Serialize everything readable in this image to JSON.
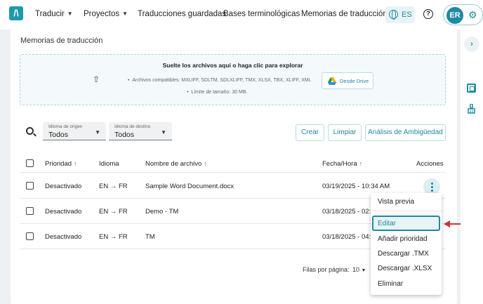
{
  "nav": {
    "logo": "/\\",
    "items": [
      "Traducir",
      "Proyectos",
      "Traducciones guardadas",
      "Bases terminológicas",
      "Memorias de traducción"
    ],
    "language": "ES",
    "help": "?",
    "avatar_initials": "ER"
  },
  "page": {
    "title": "Memorias de traducción"
  },
  "dropzone": {
    "title": "Suelte los archivos aquí o haga clic para explorar",
    "formats": "Archivos compatibles: MXLIFF, SDLTM, SDLXLIFF, TMX, XLSX, TBX, XLIFF, XML",
    "size": "Límite de tamaño: 30 MB.",
    "drive_button": "Desde Drive"
  },
  "filters": {
    "source_label": "Idioma de origen",
    "source_value": "Todos",
    "target_label": "Idioma de destino",
    "target_value": "Todos",
    "create": "Crear",
    "clear": "Limpiar",
    "ambiguity": "Análisis de Ambigüedad"
  },
  "table": {
    "headers": {
      "priority": "Prioridad",
      "language": "Idioma",
      "filename": "Nombre de archivo",
      "datetime": "Fecha/Hora",
      "actions": "Acciones"
    },
    "rows": [
      {
        "priority": "Desactivado",
        "lang": "EN → FR",
        "filename": "Sample Word Document.docx",
        "datetime": "03/19/2025 - 10:34 AM"
      },
      {
        "priority": "Desactivado",
        "lang": "EN → FR",
        "filename": "Demo - TM",
        "datetime": "03/18/2025 - 02:04"
      },
      {
        "priority": "Desactivado",
        "lang": "EN → FR",
        "filename": "TM",
        "datetime": "03/18/2025 - 04:19"
      }
    ]
  },
  "pagination": {
    "label": "Filas por página:",
    "value": "10"
  },
  "menu": {
    "items": [
      "Vista previa",
      "Editar",
      "Añadir prioridad",
      "Descargar .TMX",
      "Descargar .XLSX",
      "Eliminar"
    ],
    "active": "Editar"
  },
  "colors": {
    "accent": "#1f8aa0",
    "annotation_arrow": "#d0302f"
  }
}
